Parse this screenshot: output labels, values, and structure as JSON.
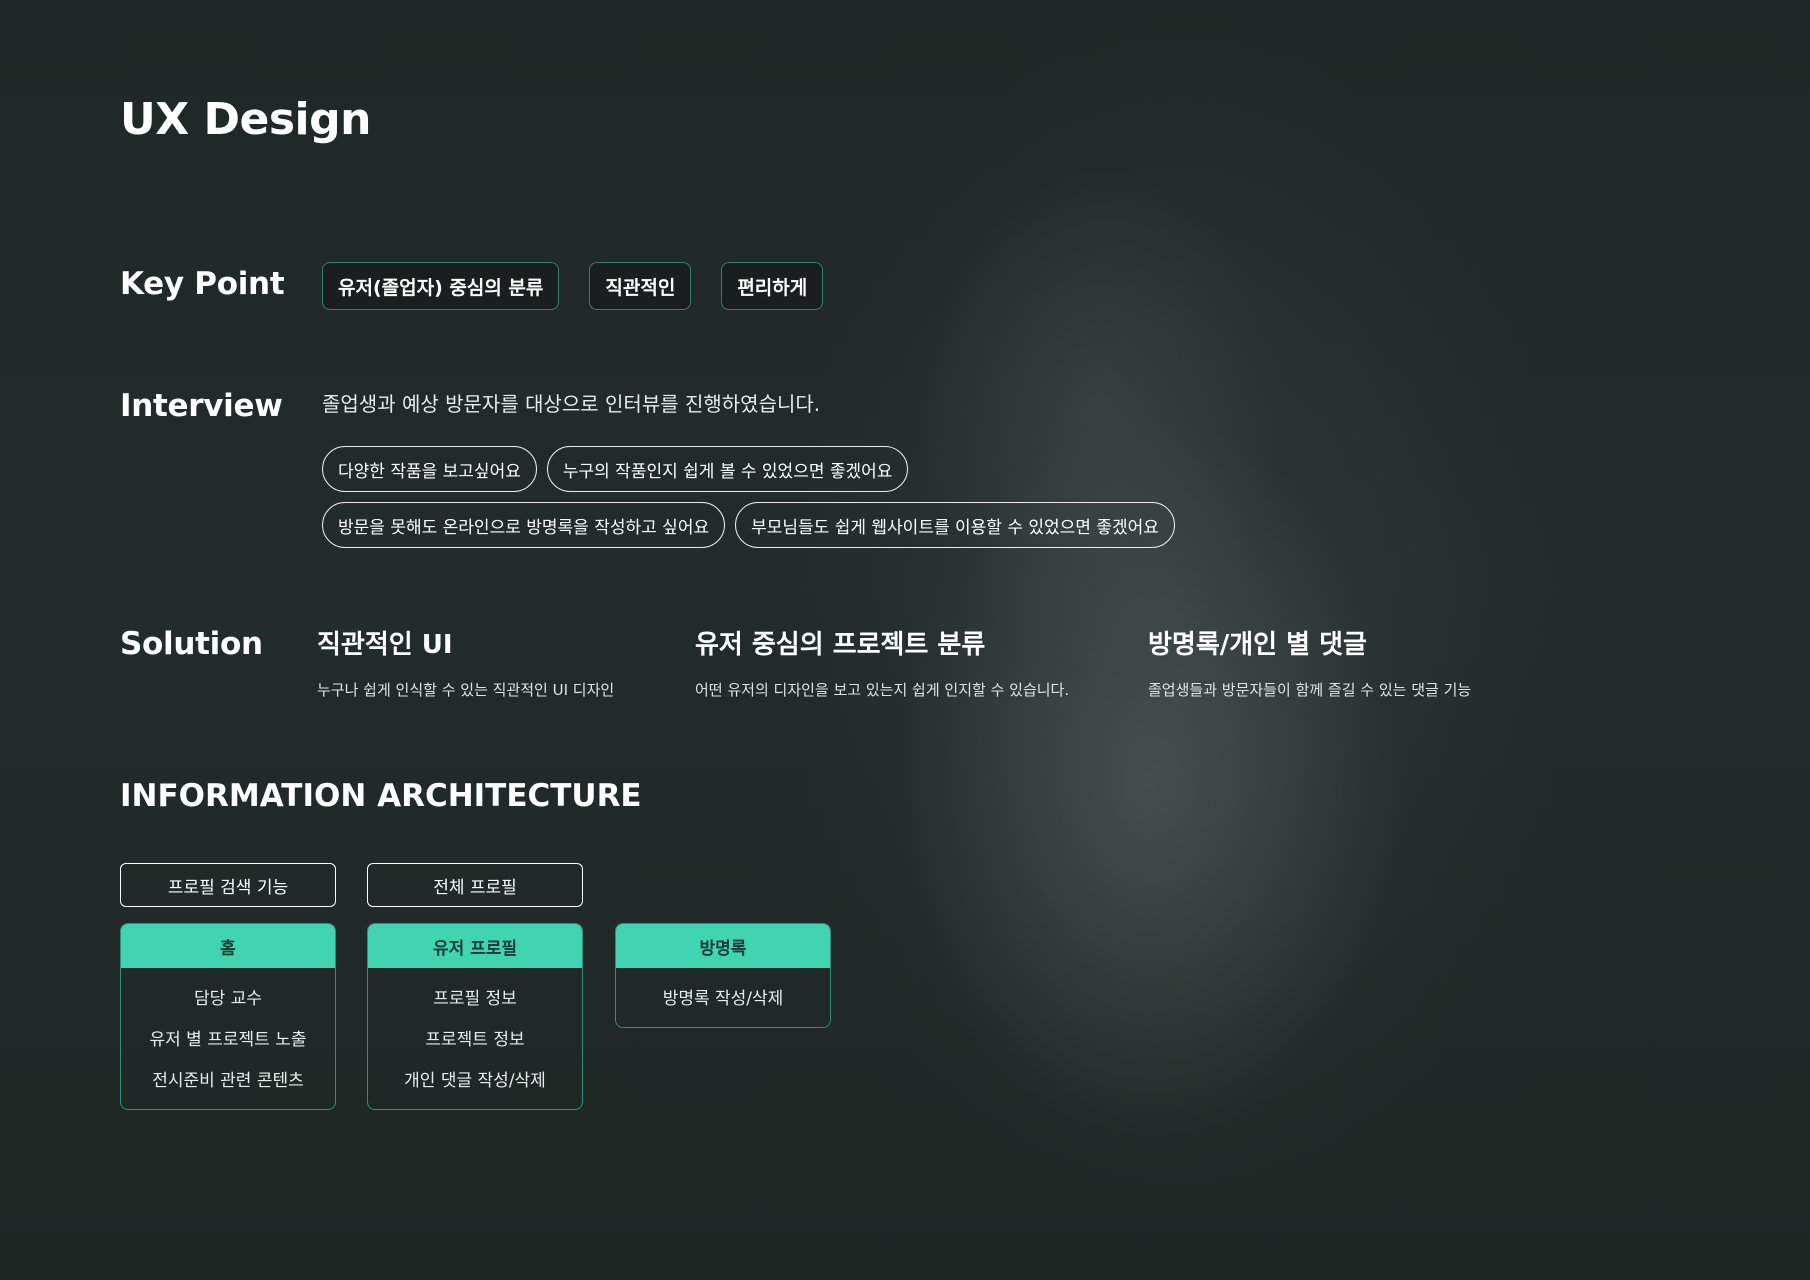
{
  "page_title": "UX Design",
  "key_point": {
    "label": "Key Point",
    "tags": [
      "유저(졸업자) 중심의 분류",
      "직관적인",
      "편리하게"
    ]
  },
  "interview": {
    "label": "Interview",
    "text": "졸업생과 예상 방문자를 대상으로 인터뷰를 진행하였습니다.",
    "quotes_row1": [
      "다양한 작품을 보고싶어요",
      "누구의 작품인지 쉽게 볼 수 있었으면 좋겠어요"
    ],
    "quotes_row2": [
      "방문을 못해도 온라인으로 방명록을 작성하고 싶어요",
      "부모님들도 쉽게 웹사이트를 이용할 수 있었으면 좋겠어요"
    ]
  },
  "solution": {
    "label": "Solution",
    "items": [
      {
        "title": "직관적인 UI",
        "desc": "누구나 쉽게 인식할 수 있는 직관적인 UI 디자인"
      },
      {
        "title": "유저 중심의 프로젝트 분류",
        "desc": "어떤 유저의 디자인을 보고 있는지 쉽게 인지할 수 있습니다."
      },
      {
        "title": "방명록/개인 별 댓글",
        "desc": "졸업생들과 방문자들이 함께 즐길 수 있는 댓글 기능"
      }
    ]
  },
  "ia": {
    "title": "INFORMATION ARCHITECTURE",
    "top_boxes": [
      "프로필 검색 기능",
      "전체 프로필"
    ],
    "columns": [
      {
        "head": "홈",
        "items": [
          "담당 교수",
          "유저 별 프로젝트 노출",
          "전시준비 관련 콘텐츠"
        ]
      },
      {
        "head": "유저 프로필",
        "items": [
          "프로필 정보",
          "프로젝트 정보",
          "개인 댓글 작성/삭제"
        ]
      },
      {
        "head": "방명록",
        "items": [
          "방명록 작성/삭제"
        ]
      }
    ]
  },
  "colors": {
    "accent": "#40d5b0",
    "background": "#1f2826",
    "tag_background": "#1b1e1e"
  }
}
